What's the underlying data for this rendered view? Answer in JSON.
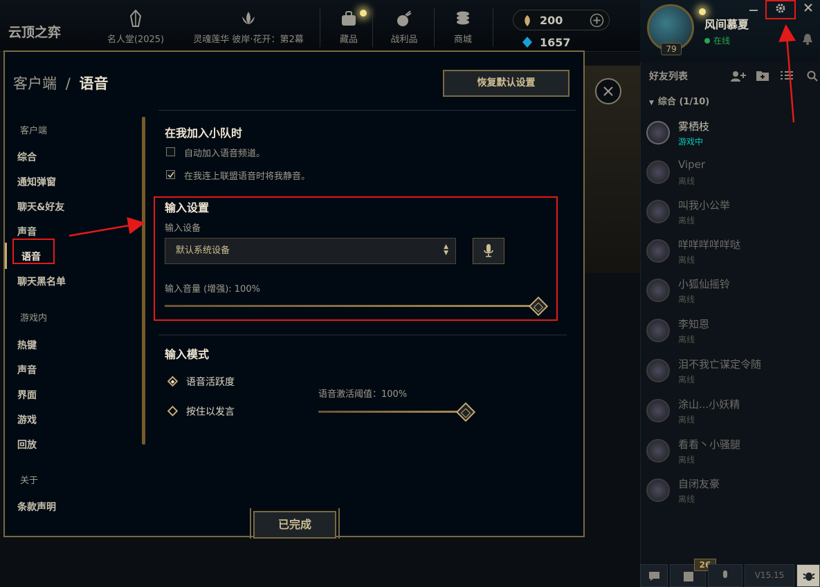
{
  "app": {
    "logo": "云顶之弈"
  },
  "topnav": [
    {
      "label": "名人堂(2025)"
    },
    {
      "label": "灵魂莲华 彼岸·花开：第2幕"
    },
    {
      "label": "藏品"
    },
    {
      "label": "战利品"
    },
    {
      "label": "商城"
    }
  ],
  "currency": {
    "gold": "200",
    "blue": "1657"
  },
  "profile": {
    "name": "风间慕夏",
    "status": "在线",
    "level": "79"
  },
  "friends": {
    "title": "好友列表",
    "group": "综合 (1/10)",
    "items": [
      {
        "name": "雾栖枝",
        "status": "游戏中",
        "online": true
      },
      {
        "name": "Viper",
        "status": "离线"
      },
      {
        "name": "叫我小公举",
        "status": "离线"
      },
      {
        "name": "咩咩咩咩咩哒",
        "status": "离线"
      },
      {
        "name": "小狐仙摇铃",
        "status": "离线"
      },
      {
        "name": "李知恩",
        "status": "离线"
      },
      {
        "name": "泪不我亡谋定令随",
        "status": "离线"
      },
      {
        "name": "涂山...小妖精",
        "status": "离线"
      },
      {
        "name": "看看丶小骚腿",
        "status": "离线"
      },
      {
        "name": "自闭友豪",
        "status": "离线"
      }
    ]
  },
  "bottom": {
    "badge": "26",
    "version": "V15.15"
  },
  "settings": {
    "breadcrumb_parent": "客户端",
    "breadcrumb_sep": "/",
    "breadcrumb_current": "语音",
    "reset_label": "恢复默认设置",
    "done_label": "已完成",
    "nav": {
      "cat_client": "客户端",
      "client_items": [
        "综合",
        "通知弹窗",
        "聊天&好友",
        "声音",
        "语音",
        "聊天黑名单"
      ],
      "cat_ingame": "游戏内",
      "ingame_items": [
        "热键",
        "声音",
        "界面",
        "游戏",
        "回放"
      ],
      "cat_about": "关于",
      "about_items": [
        "条款声明"
      ]
    },
    "party": {
      "title": "在我加入小队时",
      "auto_join": {
        "label": "自动加入语音频道。",
        "checked": false
      },
      "mute_self": {
        "label": "在我连上联盟语音时将我静音。",
        "checked": true
      }
    },
    "input": {
      "title": "输入设置",
      "device_label": "输入设备",
      "device_value": "默认系统设备",
      "volume_label": "输入音量 (增强): 100%",
      "volume_percent": 100
    },
    "mode": {
      "title": "输入模式",
      "options": [
        {
          "label": "语音活跃度",
          "selected": true
        },
        {
          "label": "按住以发言",
          "selected": false
        }
      ],
      "threshold_label": "语音激活阈值：100%",
      "threshold_percent": 100
    }
  },
  "colors": {
    "gold": "#c8aa6e",
    "annotation_red": "#e31a1a",
    "online": "#2da44e",
    "ingame": "#0ac8b9"
  }
}
